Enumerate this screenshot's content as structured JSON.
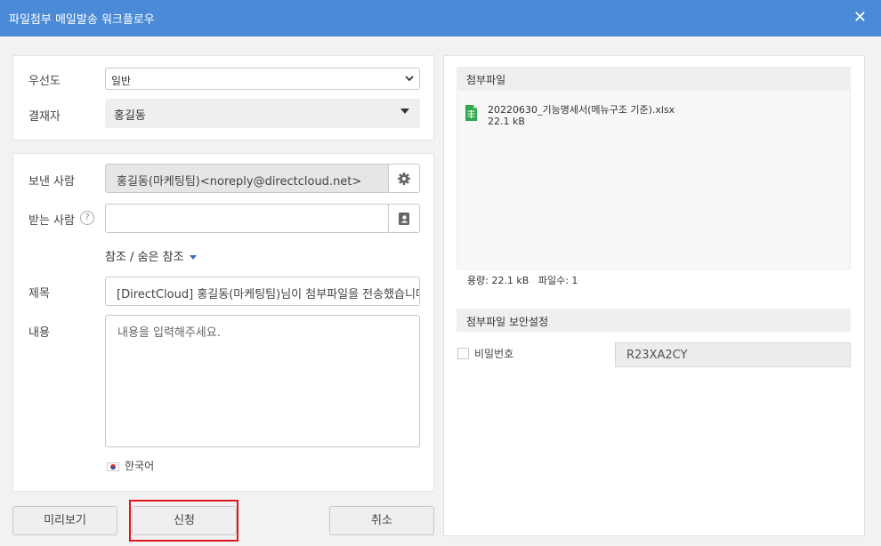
{
  "window": {
    "title": "파일첨부 메일발송 워크플로우",
    "close_glyph": "✕"
  },
  "priority": {
    "label": "우선도",
    "value": "일반"
  },
  "approver": {
    "label": "결재자",
    "value": "홍길동"
  },
  "sender": {
    "label": "보낸 사람",
    "value": "홍길동(마케팅팀)<noreply@directcloud.net>"
  },
  "recipient": {
    "label": "받는 사람",
    "help_glyph": "?",
    "value": ""
  },
  "cc_link": "참조 / 숨은 참조",
  "subject": {
    "label": "제목",
    "value": "[DirectCloud] 홍길동(마케팅팀)님이 첨부파일을 전송했습니다"
  },
  "body": {
    "label": "내용",
    "placeholder": "내용을 입력해주세요."
  },
  "language": "한국어",
  "buttons": {
    "preview": "미리보기",
    "submit": "신청",
    "cancel": "취소"
  },
  "attachments": {
    "header": "첨부파일",
    "files": [
      {
        "name": "20220630_기능명세서(메뉴구조 기준).xlsx",
        "size": "22.1 kB",
        "icon": "excel-file-icon"
      }
    ],
    "size_summary": "용량: 22.1 kB",
    "count_summary": "파일수: 1"
  },
  "security": {
    "header": "첨부파일 보안설정",
    "password_label": "비밀번호",
    "password_checked": false,
    "password_value": "R23XA2CY"
  },
  "colors": {
    "titlebar": "#4a8ad6",
    "highlight": "#e0181e",
    "excel": "#2fa84f",
    "link_arrow": "#3a6fb5"
  }
}
